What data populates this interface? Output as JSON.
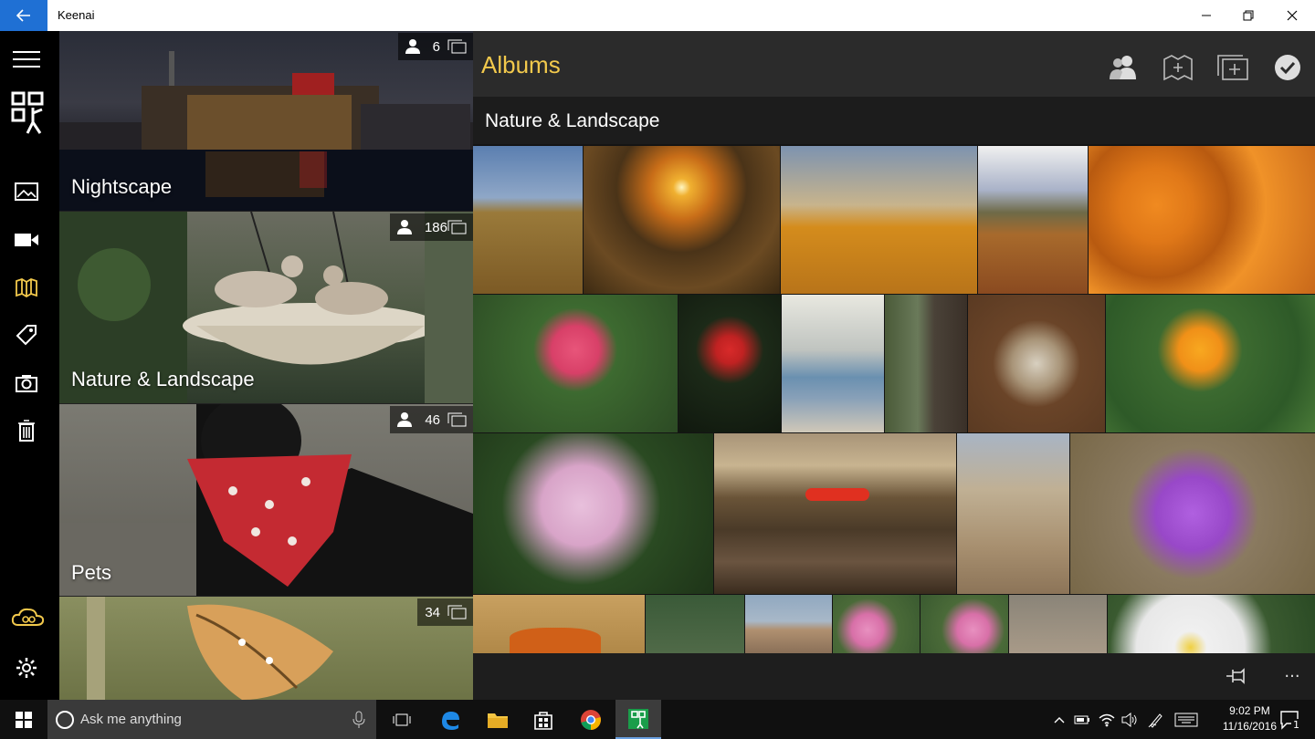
{
  "app": {
    "title": "Keenai"
  },
  "window_controls": [
    "minimize-icon",
    "restore-icon",
    "close-icon"
  ],
  "rail": {
    "items": [
      {
        "name": "menu-icon"
      },
      {
        "name": "keenai-logo-icon"
      },
      {
        "name": "photos-icon"
      },
      {
        "name": "videos-icon"
      },
      {
        "name": "albums-icon",
        "active": true
      },
      {
        "name": "tags-icon"
      },
      {
        "name": "camera-icon"
      },
      {
        "name": "trash-icon"
      },
      {
        "name": "cloud-icon"
      },
      {
        "name": "settings-icon"
      }
    ],
    "accent": "#f2c94c"
  },
  "albums": [
    {
      "name": "Nightscape",
      "count": "6"
    },
    {
      "name": "Nature & Landscape",
      "count": "186"
    },
    {
      "name": "Pets",
      "count": "46"
    },
    {
      "name": "",
      "count": "34"
    }
  ],
  "main": {
    "title": "Albums",
    "subtitle": "Nature & Landscape",
    "header_icons": [
      "people-icon",
      "add-to-album-icon",
      "add-album-icon",
      "select-check-icon"
    ],
    "command_icons": [
      "pin-icon",
      "more-icon"
    ],
    "more_label": "..."
  },
  "taskbar": {
    "search_placeholder": "Ask me anything",
    "time": "9:02 PM",
    "date": "11/16/2016",
    "notification_count": "1"
  }
}
